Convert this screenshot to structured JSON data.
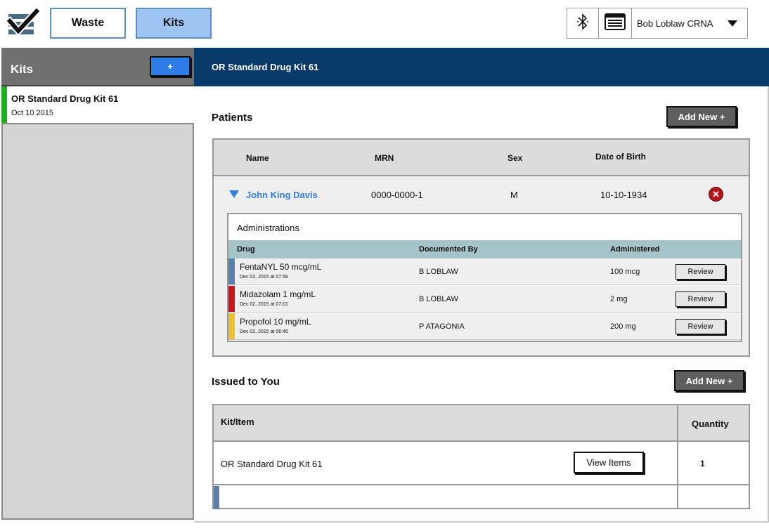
{
  "top_bar": {
    "tabs": [
      {
        "label": "Waste",
        "active": false
      },
      {
        "label": "Kits",
        "active": true
      }
    ],
    "user_label": "Bob Loblaw CRNA"
  },
  "sidebar": {
    "title": "Kits",
    "add_label": "+",
    "items": [
      {
        "title": "OR Standard Drug Kit 61",
        "date": "Oct 10 2015",
        "status_color": "#1eae1e"
      }
    ]
  },
  "main": {
    "title": "OR Standard Drug Kit 61",
    "patients": {
      "title": "Patients",
      "add_label": "Add New +",
      "columns": [
        "Name",
        "MRN",
        "Sex",
        "Date of Birth"
      ],
      "rows": [
        {
          "name": "John King Davis",
          "mrn": "0000-0000-1",
          "sex": "M",
          "dob": "10-10-1934"
        }
      ],
      "administrations": {
        "title": "Administrations",
        "columns": [
          "Drug",
          "Documented By",
          "Administered"
        ],
        "rows": [
          {
            "drug": "FentaNYL 50 mcg/mL",
            "time": "Dec 02, 2015 at 07:56",
            "documented_by": "B LOBLAW",
            "administered": "100 mcg",
            "action": "Review",
            "color": "#5b7fa8"
          },
          {
            "drug": "Midazolam 1 mg/mL",
            "time": "Dec 02, 2015 at 07:01",
            "documented_by": "B LOBLAW",
            "administered": "2 mg",
            "action": "Review",
            "color": "#c8141b"
          },
          {
            "drug": "Propofol 10 mg/mL",
            "time": "Dec 02, 2015 at 06:45",
            "documented_by": "P ATAGONIA",
            "administered": "200 mg",
            "action": "Review",
            "color": "#f0c030"
          }
        ]
      }
    },
    "issued": {
      "title": "Issued to You",
      "add_label": "Add New +",
      "columns": [
        "Kit/Item",
        "Quantity"
      ],
      "rows": [
        {
          "item": "OR Standard Drug Kit 61",
          "action": "View Items",
          "quantity": "1"
        }
      ]
    }
  },
  "icons": {
    "logo": "checkmark-logo-icon",
    "bluetooth": "bluetooth-icon",
    "list": "list-icon",
    "dropdown": "chevron-down-icon",
    "remove": "remove-circle-icon"
  },
  "colors": {
    "header_bg": "#083a6a",
    "accent_blue": "#2f7ee8",
    "sidebar_header": "#707070",
    "active_tab": "#9ec4f4",
    "admin_header": "#a5c4c9",
    "remove_red": "#b3171b"
  }
}
